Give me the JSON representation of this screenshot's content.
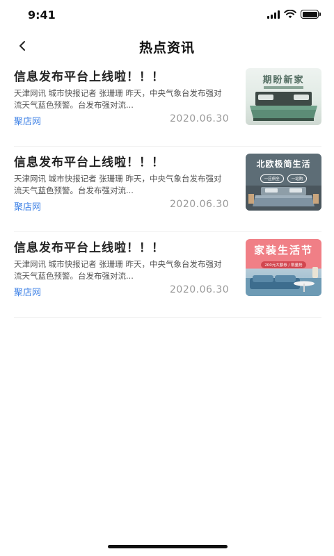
{
  "status_bar": {
    "time": "9:41"
  },
  "nav": {
    "title": "热点资讯",
    "back_icon": "chevron-left-icon"
  },
  "news": [
    {
      "title": "信息发布平台上线啦！！！",
      "summary": "天津网讯 城市快报记者 张珊珊 昨天，中央气象台发布强对流天气蓝色预警。台发布强对流...",
      "source": "聚店网",
      "date": "2020.06.30",
      "thumb": {
        "heading": "期盼新家",
        "banner": ""
      }
    },
    {
      "title": "信息发布平台上线啦！！！",
      "summary": "天津网讯 城市快报记者 张珊珊 昨天，中央气象台发布强对流天气蓝色预警。台发布强对流...",
      "source": "聚店网",
      "date": "2020.06.30",
      "thumb": {
        "heading": "北欧极简生活",
        "tag_a": "一应俱全",
        "tag_b": "一站购"
      }
    },
    {
      "title": "信息发布平台上线啦！！！",
      "summary": "天津网讯 城市快报记者 张珊珊 昨天，中央气象台发布强对流天气蓝色预警。台发布强对流...",
      "source": "聚店网",
      "date": "2020.06.30",
      "thumb": {
        "heading": "家装生活节",
        "banner": "200元大额券 / 限量抢"
      }
    }
  ],
  "colors": {
    "accent": "#3f82e6",
    "date": "#9a9a9a",
    "title": "#222222"
  }
}
